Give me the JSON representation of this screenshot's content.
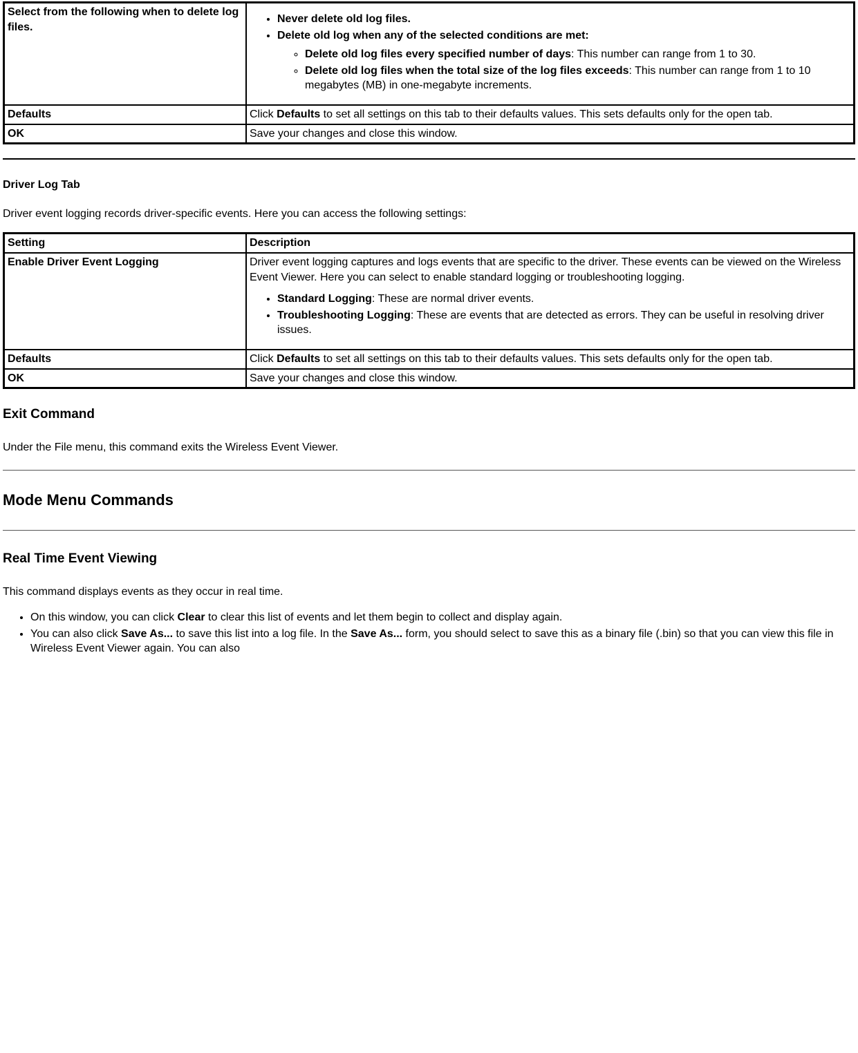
{
  "table1": {
    "row1": {
      "setting": "Select from the following when to delete log files.",
      "bullet1": "Never delete old log files.",
      "bullet2": "Delete old log when any of the selected conditions are met:",
      "sub1_label": "Delete old log files every specified number of days",
      "sub1_text": ": This number can range from 1 to 30.",
      "sub2_label": "Delete old log files when the total size of the log files exceeds",
      "sub2_text": ": This number can range from 1 to 10 megabytes (MB) in one-megabyte increments."
    },
    "row2": {
      "setting": "Defaults",
      "desc_pre": "Click ",
      "desc_bold": "Defaults",
      "desc_post": " to set all settings on this tab to their defaults values. This sets defaults only for the open tab."
    },
    "row3": {
      "setting": "OK",
      "desc": "Save your changes and close this window."
    }
  },
  "driver_log_tab": {
    "heading": "Driver Log Tab",
    "intro": "Driver event logging records driver-specific events. Here you can access the following settings:"
  },
  "table2": {
    "header": {
      "c1": "Setting",
      "c2": "Description"
    },
    "row1": {
      "setting": "Enable Driver Event Logging",
      "desc_para": "Driver event logging captures and logs events that are specific to the driver. These events can be viewed on the Wireless Event Viewer. Here you can select to enable standard logging or troubleshooting logging.",
      "b1_label": "Standard Logging",
      "b1_text": ": These are normal driver events.",
      "b2_label": "Troubleshooting Logging",
      "b2_text": ": These are events that are detected as errors. They can be useful in resolving driver issues."
    },
    "row2": {
      "setting": "Defaults",
      "desc_pre": "Click ",
      "desc_bold": "Defaults",
      "desc_post": " to set all settings on this tab to their defaults values. This sets defaults only for the open tab."
    },
    "row3": {
      "setting": "OK",
      "desc": "Save your changes and close this window."
    }
  },
  "exit_command": {
    "heading": "Exit Command",
    "text": "Under the File menu, this command exits the Wireless Event Viewer."
  },
  "mode_menu": {
    "heading": "Mode Menu Commands"
  },
  "realtime": {
    "heading": "Real Time Event Viewing",
    "intro": "This command displays events as they occur in real time.",
    "b1_pre": "On this window, you can click ",
    "b1_bold": "Clear",
    "b1_post": " to clear this list of events and let them begin to collect and display again.",
    "b2_pre": "You can also click ",
    "b2_bold1": "Save As...",
    "b2_mid": " to save this list into a log file. In the ",
    "b2_bold2": "Save As...",
    "b2_post": " form, you should select to save this as a binary file (.bin) so that you can view this file in Wireless Event Viewer again. You can also"
  }
}
